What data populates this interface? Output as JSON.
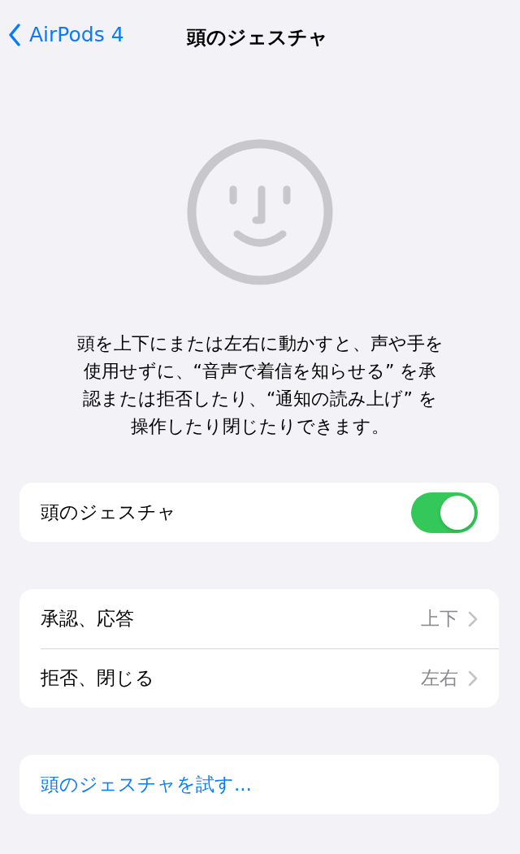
{
  "nav": {
    "back_label": "AirPods 4",
    "title": "頭のジェスチャ"
  },
  "description": "頭を上下にまたは左右に動かすと、声や手を使用せずに、“音声で着信を知らせる” を承認または拒否したり、“通知の読み上げ” を操作したり閉じたりできます。",
  "toggle_row": {
    "label": "頭のジェスチャ",
    "on": true
  },
  "gesture_rows": [
    {
      "label": "承認、応答",
      "value": "上下"
    },
    {
      "label": "拒否、閉じる",
      "value": "左右"
    }
  ],
  "try_link": "頭のジェスチャを試す..."
}
